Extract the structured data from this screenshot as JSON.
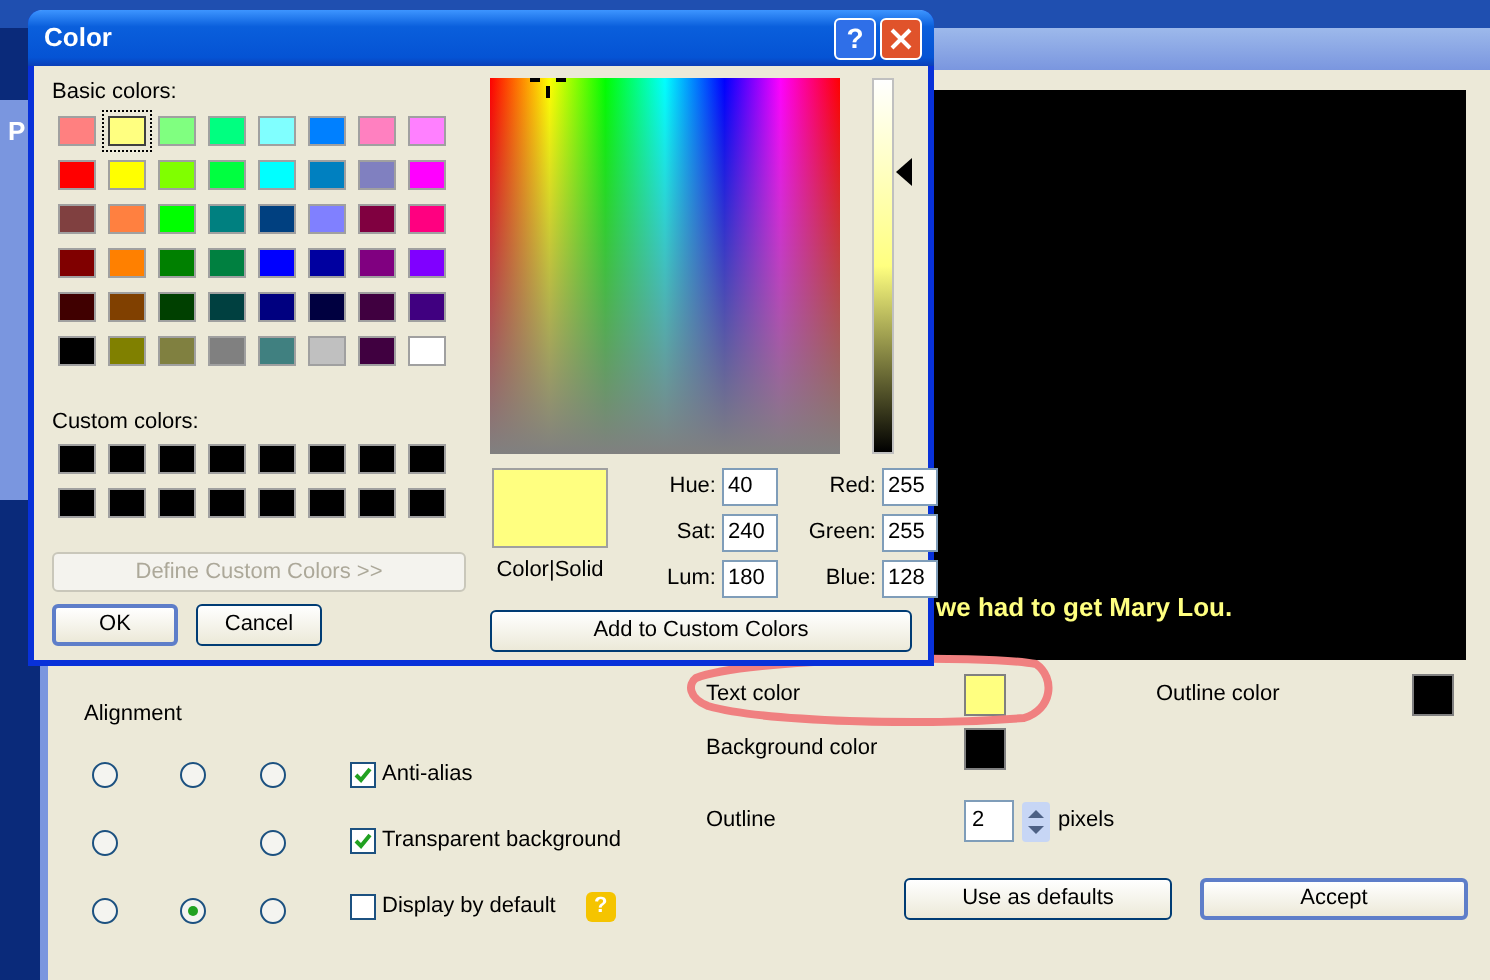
{
  "background": {
    "side_window_letter": "P"
  },
  "preview": {
    "subtitle": "we had to get Mary Lou."
  },
  "alignment": {
    "label": "Alignment",
    "cells": [
      {
        "kind": "radio",
        "selected": false
      },
      {
        "kind": "radio",
        "selected": false
      },
      {
        "kind": "radio",
        "selected": false
      },
      {
        "kind": "radio",
        "selected": false
      },
      {
        "kind": "none"
      },
      {
        "kind": "radio",
        "selected": false
      },
      {
        "kind": "radio",
        "selected": false
      },
      {
        "kind": "radio",
        "selected": true
      },
      {
        "kind": "radio",
        "selected": false
      }
    ]
  },
  "options": [
    {
      "label": "Anti-alias",
      "checked": true
    },
    {
      "label": "Transparent background",
      "checked": true
    },
    {
      "label": "Display by default",
      "checked": false,
      "help": "?"
    }
  ],
  "text_color": {
    "label": "Text color",
    "color": "#ffff80"
  },
  "outline_color": {
    "label": "Outline color",
    "color": "#000000"
  },
  "background_color": {
    "label": "Background color",
    "color": "#000000"
  },
  "outline": {
    "label": "Outline",
    "value": "2",
    "unit": "pixels"
  },
  "buttons": [
    {
      "label": "Use as defaults",
      "default": false
    },
    {
      "label": "Accept",
      "default": true
    }
  ],
  "color_dialog": {
    "title": "Color",
    "help": "?",
    "basic_label": "Basic colors:",
    "basic_colors": [
      {
        "color": "#ff8080",
        "selected": false
      },
      {
        "color": "#ffff80",
        "selected": true
      },
      {
        "color": "#80ff80",
        "selected": false
      },
      {
        "color": "#00ff80",
        "selected": false
      },
      {
        "color": "#80ffff",
        "selected": false
      },
      {
        "color": "#0080ff",
        "selected": false
      },
      {
        "color": "#ff80c0",
        "selected": false
      },
      {
        "color": "#ff80ff",
        "selected": false
      },
      {
        "color": "#ff0000",
        "selected": false
      },
      {
        "color": "#ffff00",
        "selected": false
      },
      {
        "color": "#80ff00",
        "selected": false
      },
      {
        "color": "#00ff40",
        "selected": false
      },
      {
        "color": "#00ffff",
        "selected": false
      },
      {
        "color": "#0080c0",
        "selected": false
      },
      {
        "color": "#8080c0",
        "selected": false
      },
      {
        "color": "#ff00ff",
        "selected": false
      },
      {
        "color": "#804040",
        "selected": false
      },
      {
        "color": "#ff8040",
        "selected": false
      },
      {
        "color": "#00ff00",
        "selected": false
      },
      {
        "color": "#008080",
        "selected": false
      },
      {
        "color": "#004080",
        "selected": false
      },
      {
        "color": "#8080ff",
        "selected": false
      },
      {
        "color": "#800040",
        "selected": false
      },
      {
        "color": "#ff0080",
        "selected": false
      },
      {
        "color": "#800000",
        "selected": false
      },
      {
        "color": "#ff8000",
        "selected": false
      },
      {
        "color": "#008000",
        "selected": false
      },
      {
        "color": "#008040",
        "selected": false
      },
      {
        "color": "#0000ff",
        "selected": false
      },
      {
        "color": "#0000a0",
        "selected": false
      },
      {
        "color": "#800080",
        "selected": false
      },
      {
        "color": "#8000ff",
        "selected": false
      },
      {
        "color": "#400000",
        "selected": false
      },
      {
        "color": "#804000",
        "selected": false
      },
      {
        "color": "#004000",
        "selected": false
      },
      {
        "color": "#004040",
        "selected": false
      },
      {
        "color": "#000080",
        "selected": false
      },
      {
        "color": "#000040",
        "selected": false
      },
      {
        "color": "#400040",
        "selected": false
      },
      {
        "color": "#400080",
        "selected": false
      },
      {
        "color": "#000000",
        "selected": false
      },
      {
        "color": "#808000",
        "selected": false
      },
      {
        "color": "#808040",
        "selected": false
      },
      {
        "color": "#808080",
        "selected": false
      },
      {
        "color": "#408080",
        "selected": false
      },
      {
        "color": "#c0c0c0",
        "selected": false
      },
      {
        "color": "#400040",
        "selected": false
      },
      {
        "color": "#ffffff",
        "selected": false
      }
    ],
    "custom_label": "Custom colors:",
    "custom_colors": [
      {
        "color": "#000000"
      },
      {
        "color": "#000000"
      },
      {
        "color": "#000000"
      },
      {
        "color": "#000000"
      },
      {
        "color": "#000000"
      },
      {
        "color": "#000000"
      },
      {
        "color": "#000000"
      },
      {
        "color": "#000000"
      },
      {
        "color": "#000000"
      },
      {
        "color": "#000000"
      },
      {
        "color": "#000000"
      },
      {
        "color": "#000000"
      },
      {
        "color": "#000000"
      },
      {
        "color": "#000000"
      },
      {
        "color": "#000000"
      },
      {
        "color": "#000000"
      }
    ],
    "define_button": {
      "label": "Define Custom Colors >>",
      "disabled": true
    },
    "ok": "OK",
    "cancel": "Cancel",
    "luminance": {
      "level": 0.75
    },
    "swatch": {
      "color": "#ffff80",
      "label": "Color|Solid"
    },
    "fields": [
      {
        "label": "Hue:",
        "value": "40"
      },
      {
        "label": "Red:",
        "value": "255"
      },
      {
        "label": "Sat:",
        "value": "240"
      },
      {
        "label": "Green:",
        "value": "255"
      },
      {
        "label": "Lum:",
        "value": "180"
      },
      {
        "label": "Blue:",
        "value": "128"
      }
    ],
    "add_button": "Add to Custom Colors"
  }
}
